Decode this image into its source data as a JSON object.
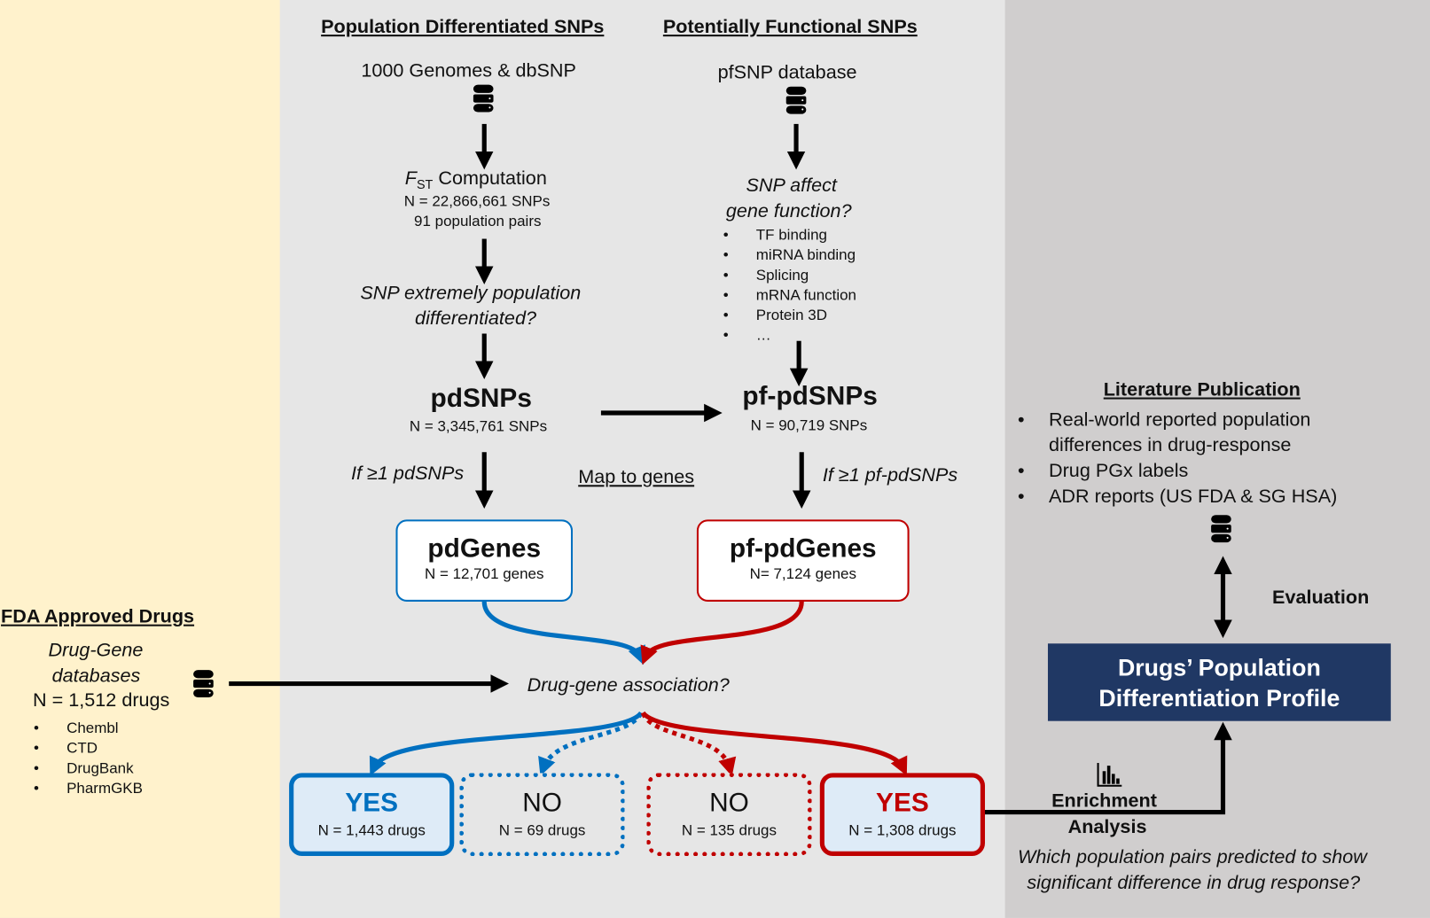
{
  "colors": {
    "panel_left_bg": "#fff2cc",
    "panel_mid_bg": "#e6e6e6",
    "panel_right_bg": "#d0cece",
    "blue": "#0070c0",
    "red": "#c00000",
    "navy": "#203864",
    "result_box_bg": "#deebf7"
  },
  "pd_column": {
    "header": "Population Differentiated SNPs",
    "source": "1000 Genomes & dbSNP",
    "source_icon": "database-icon",
    "fst_symbol": "F",
    "fst_subscript": "ST",
    "fst_label": " Computation",
    "fst_n": "N = 22,866,661 SNPs",
    "fst_pairs": "91 population pairs",
    "question_line1": "SNP extremely population",
    "question_line2": "differentiated?",
    "result_title": "pdSNPs",
    "result_n": "N = 3,345,761 SNPs",
    "condition": "If ≥1 pdSNPs",
    "genes_title": "pdGenes",
    "genes_n": "N = 12,701 genes"
  },
  "pf_column": {
    "header": "Potentially Functional SNPs",
    "source": "pfSNP database",
    "source_icon": "database-icon",
    "question_line1": "SNP affect",
    "question_line2": "gene function?",
    "criteria": [
      "TF binding",
      "miRNA binding",
      "Splicing",
      "mRNA function",
      "Protein 3D",
      "…"
    ],
    "result_title": "pf-pdSNPs",
    "result_n": "N = 90,719 SNPs",
    "condition": "If ≥1 pf-pdSNPs",
    "genes_title": "pf-pdGenes",
    "genes_n": "N= 7,124 genes"
  },
  "map_to_genes": "Map to genes",
  "drugs": {
    "header": "FDA Approved Drugs",
    "db_line1": "Drug-Gene",
    "db_line2": "databases",
    "n": "N = 1,512 drugs",
    "icon": "database-icon",
    "sources": [
      "Chembl",
      "CTD",
      "DrugBank",
      "PharmGKB"
    ]
  },
  "association_question": "Drug-gene association?",
  "results": [
    {
      "label": "YES",
      "n": "N = 1,443 drugs",
      "color": "blue",
      "style": "solid"
    },
    {
      "label": "NO",
      "n": "N = 69 drugs",
      "color": "blue",
      "style": "dotted"
    },
    {
      "label": "NO",
      "n": "N = 135 drugs",
      "color": "red",
      "style": "dotted"
    },
    {
      "label": "YES",
      "n": "N = 1,308 drugs",
      "color": "red",
      "style": "solid"
    }
  ],
  "literature": {
    "header": "Literature Publication",
    "items": [
      "Real-world reported population differences in drug-response",
      "Drug PGx labels",
      "ADR reports (US FDA & SG HSA)"
    ],
    "icon": "database-icon"
  },
  "evaluation_label": "Evaluation",
  "profile_line1": "Drugs’ Population",
  "profile_line2": "Differentiation Profile",
  "enrichment": {
    "icon": "bar-chart-icon",
    "line1": "Enrichment",
    "line2": "Analysis",
    "question_line1": "Which population pairs predicted to show",
    "question_line2": "significant difference in drug response?"
  }
}
